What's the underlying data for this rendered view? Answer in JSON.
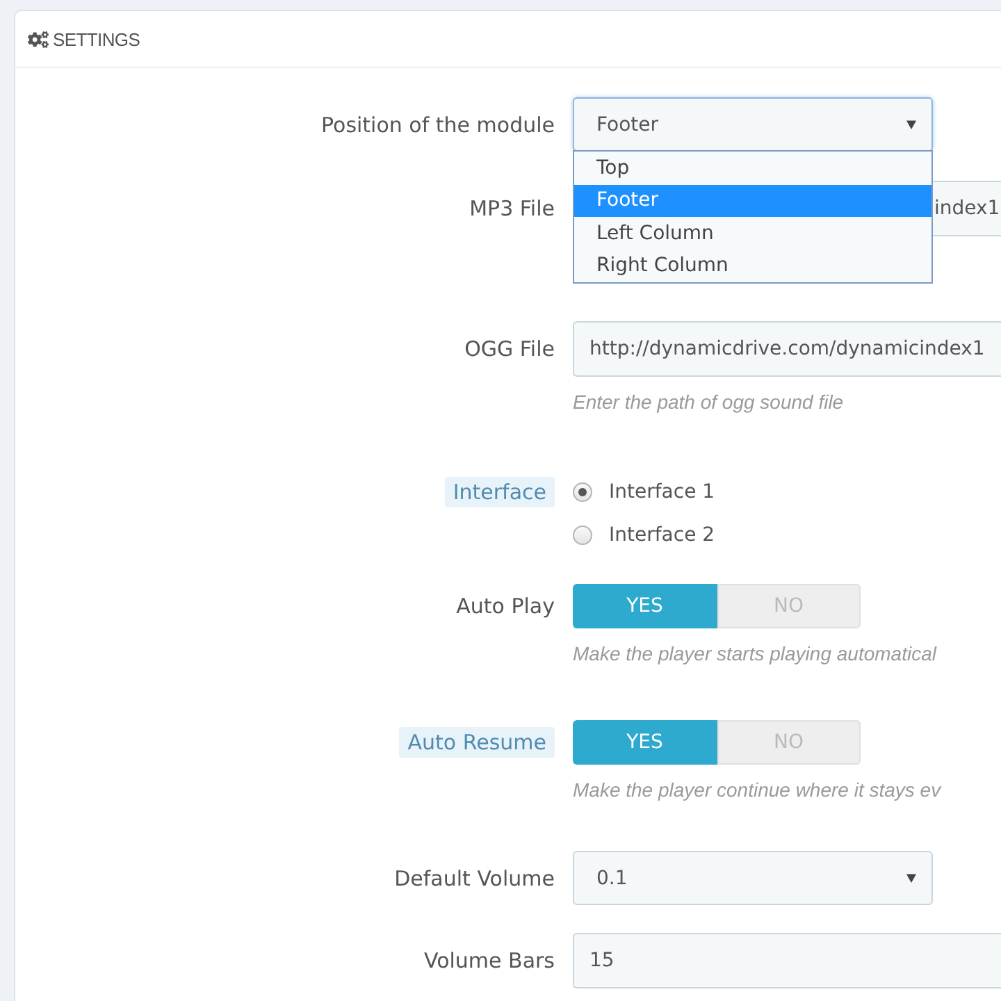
{
  "panel": {
    "title": "SETTINGS"
  },
  "fields": [
    {
      "kind": "select",
      "label": "Position of the module",
      "label_hint": false,
      "value": "Footer",
      "open": true,
      "options": [
        {
          "label": "Top",
          "selected": false
        },
        {
          "label": "Footer",
          "selected": true
        },
        {
          "label": "Left Column",
          "selected": false
        },
        {
          "label": "Right Column",
          "selected": false
        }
      ]
    },
    {
      "kind": "text",
      "label": "MP3 File",
      "label_hint": false,
      "value": "index1"
    },
    {
      "kind": "text",
      "label": "OGG File",
      "label_hint": false,
      "value": "http://dynamicdrive.com/dynamicindex1",
      "help": "Enter the path of ogg sound file"
    },
    {
      "kind": "radio",
      "label": "Interface",
      "label_hint": true,
      "options": [
        {
          "label": "Interface 1",
          "selected": true
        },
        {
          "label": "Interface 2",
          "selected": false
        }
      ]
    },
    {
      "kind": "toggle",
      "label": "Auto Play",
      "label_hint": false,
      "options": [
        {
          "label": "YES",
          "selected": true
        },
        {
          "label": "NO",
          "selected": false
        }
      ],
      "help": "Make the player starts playing automatical"
    },
    {
      "kind": "toggle",
      "label": "Auto Resume",
      "label_hint": true,
      "options": [
        {
          "label": "YES",
          "selected": true
        },
        {
          "label": "NO",
          "selected": false
        }
      ],
      "help": "Make the player continue where it stays ev"
    },
    {
      "kind": "select",
      "label": "Default Volume",
      "label_hint": false,
      "value": "0.1",
      "open": false
    },
    {
      "kind": "text",
      "label": "Volume Bars",
      "label_hint": false,
      "value": "15"
    }
  ]
}
